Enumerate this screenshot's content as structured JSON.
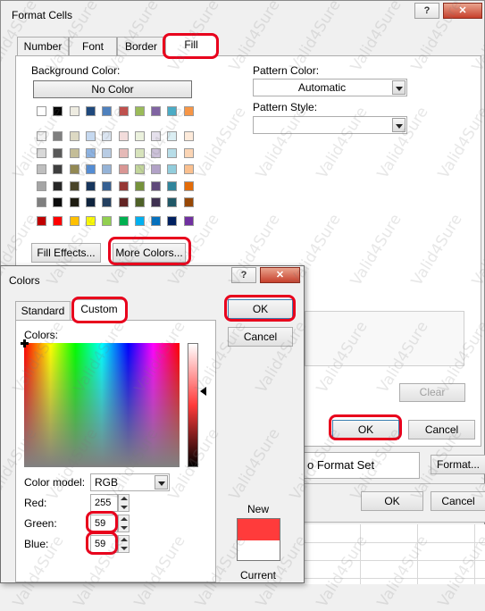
{
  "format_cells": {
    "title": "Format Cells",
    "help_btn": "?",
    "close_btn": "✕",
    "tabs": [
      "Number",
      "Font",
      "Border",
      "Fill"
    ],
    "background_color_label": "Background Color:",
    "no_color_label": "No Color",
    "pattern_color_label": "Pattern Color:",
    "pattern_color_value": "Automatic",
    "pattern_style_label": "Pattern Style:",
    "pattern_style_value": "",
    "fill_effects_label": "Fill Effects...",
    "more_colors_label": "More Colors...",
    "clear_label": "Clear",
    "ok_label": "OK",
    "cancel_label": "Cancel"
  },
  "palette": {
    "row1": [
      "#ffffff",
      "#000000",
      "#eeece1",
      "#1f497d",
      "#4f81bd",
      "#c0504d",
      "#9bbb59",
      "#8064a2",
      "#4bacc6",
      "#f79646"
    ],
    "rows": [
      [
        "#f2f2f2",
        "#7f7f7f",
        "#ddd9c3",
        "#c6d9f0",
        "#dbe5f1",
        "#f2dcdb",
        "#ebf1dd",
        "#e5e0ec",
        "#dbeef3",
        "#fdeada"
      ],
      [
        "#d8d8d8",
        "#595959",
        "#c4bd97",
        "#8db3e2",
        "#b8cce4",
        "#e5b9b7",
        "#d7e3bc",
        "#ccc1d9",
        "#b7dde8",
        "#fbd5b5"
      ],
      [
        "#bfbfbf",
        "#3f3f3f",
        "#938953",
        "#548dd4",
        "#95b3d7",
        "#d99694",
        "#c3d69b",
        "#b2a2c7",
        "#92cddc",
        "#fac08f"
      ],
      [
        "#a5a5a5",
        "#262626",
        "#494429",
        "#17365d",
        "#366092",
        "#953734",
        "#76923c",
        "#5f497a",
        "#31859b",
        "#e36c09"
      ],
      [
        "#7f7f7f",
        "#0c0c0c",
        "#1d1b10",
        "#0f243e",
        "#244061",
        "#632423",
        "#4f6128",
        "#3f3151",
        "#205867",
        "#974806"
      ]
    ],
    "standard": [
      "#c00000",
      "#ff0000",
      "#ffc000",
      "#ffff00",
      "#92d050",
      "#00b050",
      "#00b0f0",
      "#0070c0",
      "#002060",
      "#7030a0"
    ]
  },
  "colors_dialog": {
    "title": "Colors",
    "help_btn": "?",
    "close_btn": "✕",
    "tabs": [
      "Standard",
      "Custom"
    ],
    "colors_label": "Colors:",
    "ok_label": "OK",
    "cancel_label": "Cancel",
    "color_model_label": "Color model:",
    "color_model_value": "RGB",
    "red_label": "Red:",
    "red_value": "255",
    "green_label": "Green:",
    "green_value": "59",
    "blue_label": "Blue:",
    "blue_value": "59",
    "new_label": "New",
    "current_label": "Current",
    "new_color": "#ff3b3b",
    "current_color": "#ffffff"
  },
  "background": {
    "format_set_text": "o Format Set",
    "format_btn": "Format...",
    "ok_label": "OK",
    "cancel_label": "Cancel"
  },
  "watermark": "Valid4Sure"
}
